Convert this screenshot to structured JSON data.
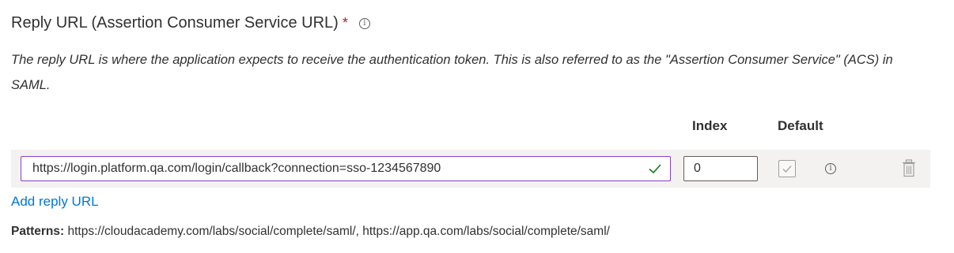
{
  "section": {
    "title": "Reply URL (Assertion Consumer Service URL)",
    "required_marker": "*",
    "info_glyph": "i",
    "description": "The reply URL is where the application expects to receive the authentication token. This is also referred to as the \"Assertion Consumer Service\" (ACS) in SAML."
  },
  "columns": {
    "index": "Index",
    "default": "Default"
  },
  "reply_urls": [
    {
      "url": "https://login.platform.qa.com/login/callback?connection=sso-1234567890",
      "index": "0",
      "is_default": false,
      "validated": true
    }
  ],
  "add_reply_url_label": "Add reply URL",
  "patterns": {
    "label": "Patterns:",
    "value": "https://cloudacademy.com/labs/social/complete/saml/, https://app.qa.com/labs/social/complete/saml/"
  },
  "icons": {
    "info": "info-icon",
    "check": "check-icon",
    "trash": "trash-icon"
  },
  "colors": {
    "required": "#a4262c",
    "link": "#0078d4",
    "input_focus_border": "#8a3ec7",
    "valid_check": "#107c10",
    "row_background": "#f3f2f1"
  }
}
